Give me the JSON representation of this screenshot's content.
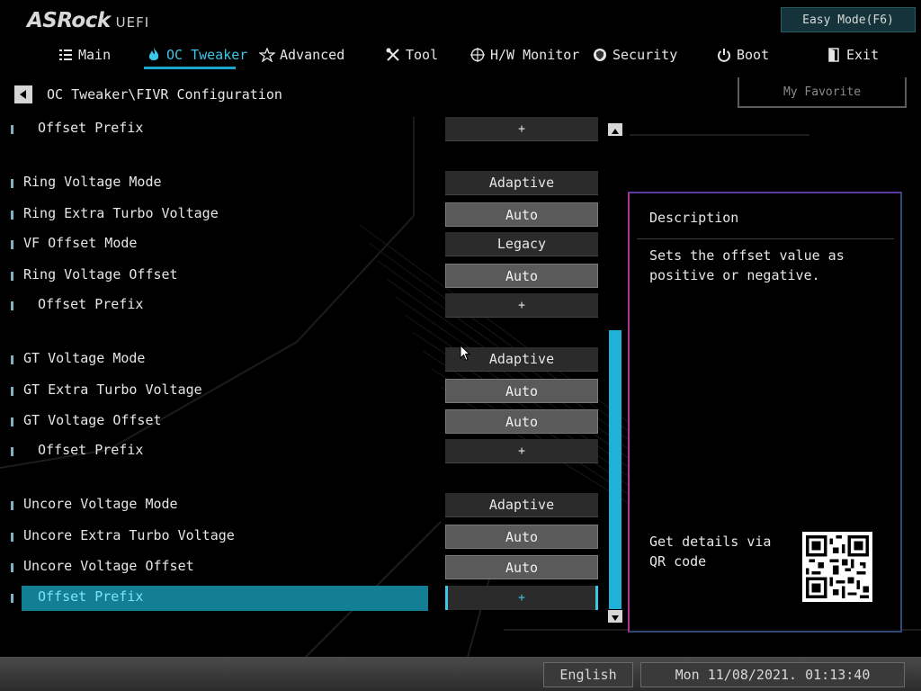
{
  "header": {
    "brand": "ASRock",
    "brand_suffix": "UEFI",
    "easy_mode_label": "Easy Mode(F6)"
  },
  "nav": {
    "items": [
      {
        "label": "Main",
        "icon": "list-icon"
      },
      {
        "label": "OC Tweaker",
        "icon": "flame-icon",
        "active": true
      },
      {
        "label": "Advanced",
        "icon": "star-icon"
      },
      {
        "label": "Tool",
        "icon": "tools-icon"
      },
      {
        "label": "H/W Monitor",
        "icon": "crosshair-icon"
      },
      {
        "label": "Security",
        "icon": "shield-icon"
      },
      {
        "label": "Boot",
        "icon": "power-icon"
      },
      {
        "label": "Exit",
        "icon": "exit-door-icon"
      }
    ],
    "accent_color": "#3cc7e6"
  },
  "breadcrumb": {
    "path": "OC Tweaker\\FIVR Configuration"
  },
  "favorite_label": "My Favorite",
  "settings": [
    {
      "label": "Offset Prefix",
      "value": "+",
      "indent": true,
      "style": "plus"
    },
    {
      "label": "Ring Voltage Mode",
      "value": "Adaptive",
      "style": "dark"
    },
    {
      "label": "Ring Extra Turbo Voltage",
      "value": "Auto",
      "style": "grey"
    },
    {
      "label": "VF Offset Mode",
      "value": "Legacy",
      "style": "dark"
    },
    {
      "label": "Ring Voltage Offset",
      "value": "Auto",
      "style": "grey"
    },
    {
      "label": "Offset Prefix",
      "value": "+",
      "indent": true,
      "style": "plus"
    },
    {
      "label": "GT Voltage Mode",
      "value": "Adaptive",
      "style": "dark"
    },
    {
      "label": "GT Extra Turbo Voltage",
      "value": "Auto",
      "style": "grey"
    },
    {
      "label": "GT Voltage Offset",
      "value": "Auto",
      "style": "grey"
    },
    {
      "label": "Offset Prefix",
      "value": "+",
      "indent": true,
      "style": "plus"
    },
    {
      "label": "Uncore Voltage Mode",
      "value": "Adaptive",
      "style": "dark"
    },
    {
      "label": "Uncore Extra Turbo Voltage",
      "value": "Auto",
      "style": "grey"
    },
    {
      "label": "Uncore Voltage Offset",
      "value": "Auto",
      "style": "grey"
    },
    {
      "label": "Offset Prefix",
      "value": "+",
      "indent": true,
      "style": "plus",
      "selected": true
    }
  ],
  "description": {
    "title": "Description",
    "text": "Sets the offset value as positive or negative.",
    "qr_text": "Get details via QR code"
  },
  "footer": {
    "language": "English",
    "datetime": "Mon 11/08/2021. 01:13:40"
  },
  "colors": {
    "selection": "#127f95",
    "scroll_thumb": "#1fb2d8",
    "easy_mode_bg": "#14333a"
  }
}
